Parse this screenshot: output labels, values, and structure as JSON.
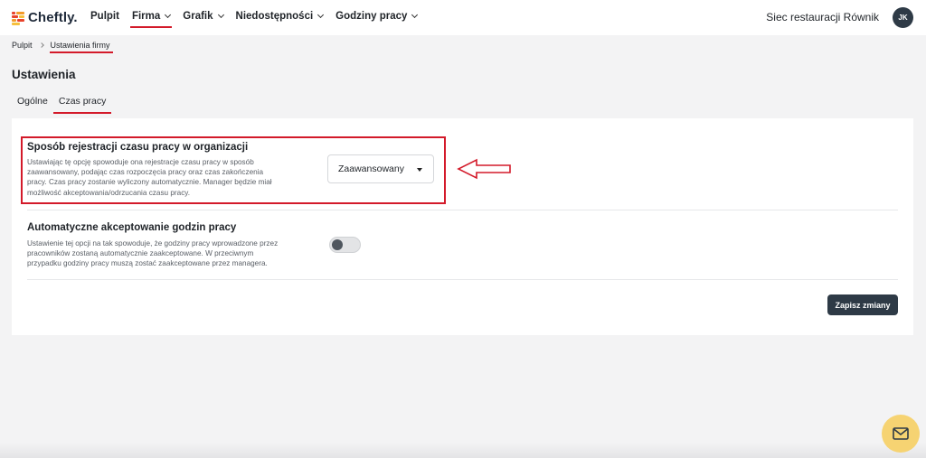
{
  "app": {
    "logo_text": "Cheftly."
  },
  "nav": [
    {
      "label": "Pulpit"
    },
    {
      "label": "Firma"
    },
    {
      "label": "Grafik"
    },
    {
      "label": "Niedostępności"
    },
    {
      "label": "Godziny pracy"
    }
  ],
  "header": {
    "org_name": "Siec restauracji Równik",
    "avatar_initials": "JK"
  },
  "breadcrumb": {
    "root": "Pulpit",
    "current": "Ustawienia firmy"
  },
  "page": {
    "title": "Ustawienia"
  },
  "tabs": [
    {
      "label": "Ogólne"
    },
    {
      "label": "Czas pracy"
    }
  ],
  "settings": {
    "registration": {
      "title": "Sposób rejestracji czasu pracy w organizacji",
      "desc_lines": [
        "Ustawiając tę opcję spowoduje ona rejestracje czasu pracy w sposób",
        "zaawansowany, podając czas rozpoczęcia pracy oraz czas zakończenia",
        "pracy. Czas pracy zostanie wyliczony automatycznie. Manager będzie miał",
        "możliwość akceptowania/odrzucania czasu pracy."
      ],
      "selected": "Zaawansowany"
    },
    "auto_accept": {
      "title": "Automatyczne akceptowanie godzin pracy",
      "desc_lines": [
        "Ustawienie tej opcji na tak spowoduje, że godziny pracy wprowadzone przez",
        "pracowników zostaną automatycznie zaakceptowane. W przeciwnym",
        "przypadku godziny pracy muszą zostać zaakceptowane przez managera."
      ],
      "enabled": false
    }
  },
  "actions": {
    "save_label": "Zapisz zmiany"
  },
  "colors": {
    "accent_red": "#d31a2a",
    "dark": "#2e3a46",
    "fab": "#f6d372"
  },
  "icons": {
    "logo": "cheftly-logo-icon",
    "mail": "mail-icon",
    "arrow": "annotation-arrow-icon"
  }
}
